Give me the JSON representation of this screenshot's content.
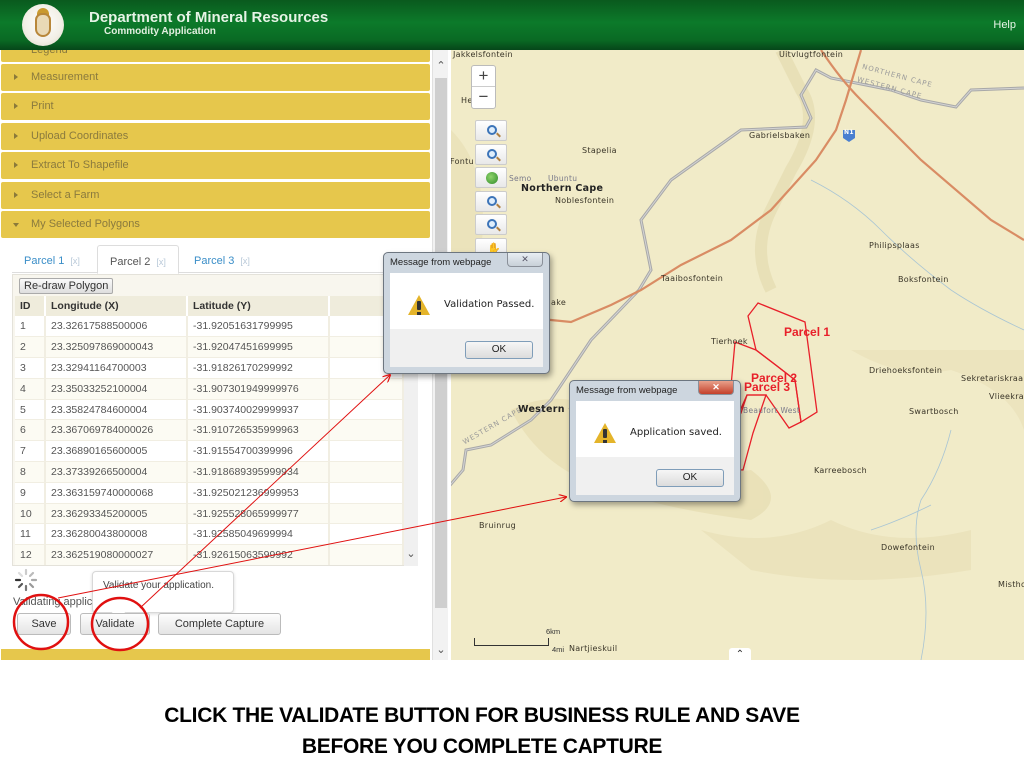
{
  "header": {
    "title": "Department of Mineral Resources",
    "subtitle": "Commodity Application",
    "help_label": "Help",
    "logo_icon": "coat-of-arms-icon"
  },
  "sidebar": {
    "accordion": [
      {
        "label": "Legend",
        "expanded": false
      },
      {
        "label": "Measurement",
        "expanded": false
      },
      {
        "label": "Print",
        "expanded": false
      },
      {
        "label": "Upload Coordinates",
        "expanded": false
      },
      {
        "label": "Extract To Shapefile",
        "expanded": false
      },
      {
        "label": "Select a Farm",
        "expanded": false
      },
      {
        "label": "My Selected Polygons",
        "expanded": true
      }
    ],
    "tabs": [
      {
        "label": "Parcel 1",
        "close": "[x]",
        "active": false
      },
      {
        "label": "Parcel 2",
        "close": "[x]",
        "active": true
      },
      {
        "label": "Parcel 3",
        "close": "[x]",
        "active": false
      }
    ],
    "redraw_label": "Re-draw Polygon",
    "table": {
      "columns": [
        "ID",
        "Longitude (X)",
        "Latitude (Y)"
      ],
      "rows": [
        [
          "1",
          "23.32617588500006",
          "-31.92051631799995"
        ],
        [
          "2",
          "23.325097869000043",
          "-31.92047451699995"
        ],
        [
          "3",
          "23.32941164700003",
          "-31.91826170299992"
        ],
        [
          "4",
          "23.35033252100004",
          "-31.907301949999976"
        ],
        [
          "5",
          "23.35824784600004",
          "-31.903740029999937"
        ],
        [
          "6",
          "23.367069784000026",
          "-31.910726535999963"
        ],
        [
          "7",
          "23.36890165600005",
          "-31.91554700399996"
        ],
        [
          "8",
          "23.37339266500004",
          "-31.918689395999934"
        ],
        [
          "9",
          "23.363159740000068",
          "-31.925021236999953"
        ],
        [
          "10",
          "23.36293345200005",
          "-31.925528065999977"
        ],
        [
          "11",
          "23.36280043800008",
          "-31.92585049699994"
        ],
        [
          "12",
          "23.362519080000027",
          "-31.92615063599992"
        ]
      ]
    },
    "status_text": "Validating applic",
    "tooltip": "Validate your application.",
    "buttons": {
      "save": "Save",
      "validate": "Validate",
      "complete": "Complete Capture"
    }
  },
  "map": {
    "zoom_in": "+",
    "zoom_out": "−",
    "tools": [
      "zoom-in-icon",
      "zoom-out-icon",
      "globe-icon",
      "zoom-previous-icon",
      "zoom-next-icon",
      "pan-hand-icon"
    ],
    "places": [
      {
        "name": "Jakkelsfontein",
        "type": "town"
      },
      {
        "name": "Uitvlugtfontein",
        "type": "town"
      },
      {
        "name": "He  bek",
        "type": "town"
      },
      {
        "name": "Gabrielsbaken",
        "type": "town"
      },
      {
        "name": "Stapelia",
        "type": "town"
      },
      {
        "name": "Semo",
        "type": "small"
      },
      {
        "name": "Ubuntu",
        "type": "small"
      },
      {
        "name": "Northern Cape",
        "type": "region"
      },
      {
        "name": "Noblesfontein",
        "type": "town"
      },
      {
        "name": "Fontu",
        "type": "town"
      },
      {
        "name": "Philipsplaas",
        "type": "town"
      },
      {
        "name": "Taaibosfontein",
        "type": "town"
      },
      {
        "name": "Boksfontein",
        "type": "town"
      },
      {
        "name": "ake",
        "type": "town"
      },
      {
        "name": "Tierhoek",
        "type": "town"
      },
      {
        "name": "Driehoeksfontein",
        "type": "town"
      },
      {
        "name": "Sekretariskraa",
        "type": "town"
      },
      {
        "name": "Vlieekra",
        "type": "town"
      },
      {
        "name": "Western C",
        "type": "region"
      },
      {
        "name": "Beaufort West",
        "type": "small"
      },
      {
        "name": "Swartbosch",
        "type": "town"
      },
      {
        "name": "Karreebosch",
        "type": "town"
      },
      {
        "name": "Bruinrug",
        "type": "town"
      },
      {
        "name": "Dowefontein",
        "type": "town"
      },
      {
        "name": "Mistho",
        "type": "town"
      },
      {
        "name": "Nartjieskuil",
        "type": "town"
      }
    ],
    "boundary_labels": [
      "NORTHERN CAPE",
      "WESTERN CAPE",
      "WESTERN CAPE"
    ],
    "road_shield": "N1",
    "parcels": [
      "Parcel 1",
      "Parcel 2",
      "Parcel 3"
    ],
    "scale": {
      "km": "6km",
      "mi": "4mi"
    }
  },
  "dialogs": [
    {
      "title": "Message from webpage",
      "message": "Validation Passed.",
      "ok": "OK",
      "close": "✕"
    },
    {
      "title": "Message from webpage",
      "message": "Application saved.",
      "ok": "OK",
      "close": "✕"
    }
  ],
  "caption": {
    "line1": "CLICK THE VALIDATE BUTTON FOR BUSINESS RULE AND SAVE",
    "line2": "BEFORE YOU COMPLETE CAPTURE"
  },
  "colors": {
    "header_green": "#0c7a2a",
    "accordion_yellow": "#e6c74c",
    "parcel_red": "#e8202a",
    "annotation_red": "#e01010"
  }
}
